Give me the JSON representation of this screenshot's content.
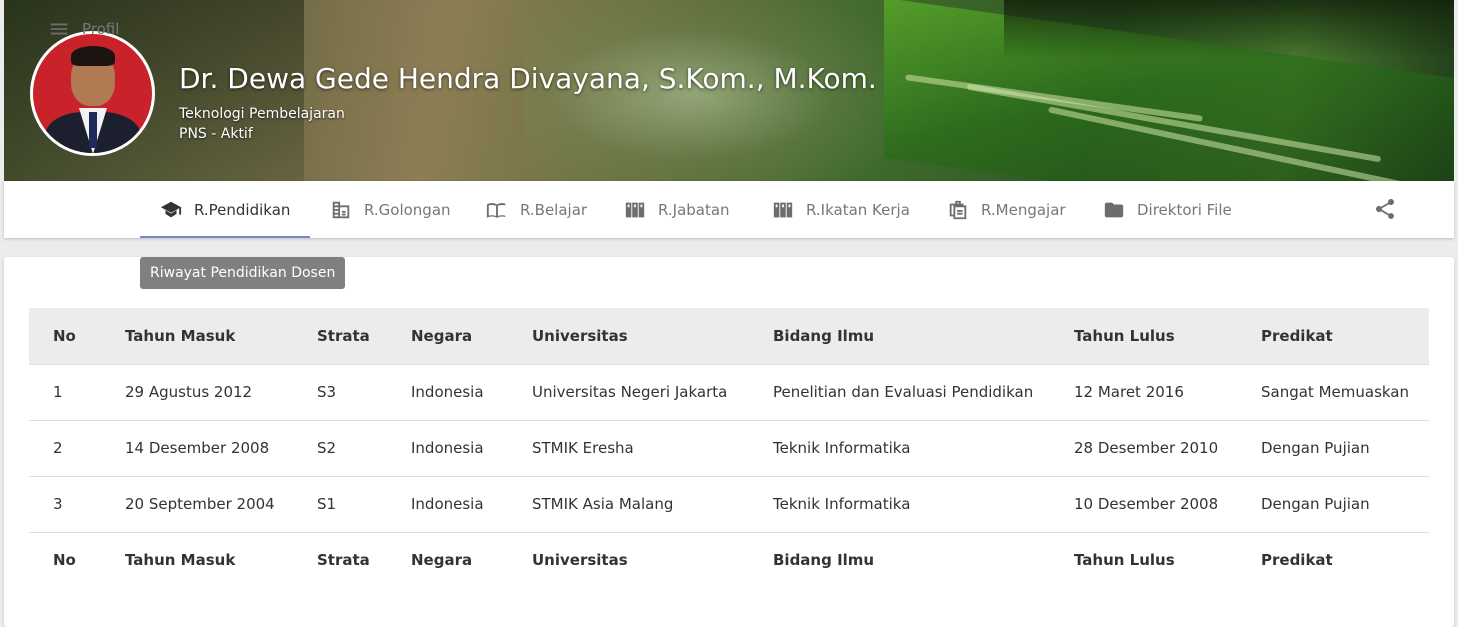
{
  "profile": {
    "name": "Dr. Dewa Gede Hendra Divayana, S.Kom., M.Kom.",
    "department": "Teknologi Pembelajaran",
    "status": "PNS - Aktif"
  },
  "tabs": [
    {
      "label": "Profil",
      "icon": "menu-icon"
    },
    {
      "label": "R.Pendidikan",
      "icon": "graduation-cap-icon",
      "active": true
    },
    {
      "label": "R.Golongan",
      "icon": "building-chart-icon"
    },
    {
      "label": "R.Belajar",
      "icon": "book-open-icon"
    },
    {
      "label": "R.Jabatan",
      "icon": "binders-icon"
    },
    {
      "label": "R.Ikatan Kerja",
      "icon": "binders-icon"
    },
    {
      "label": "R.Mengajar",
      "icon": "clipboard-icon"
    },
    {
      "label": "Direktori File",
      "icon": "folder-icon"
    }
  ],
  "share_icon": "share-icon",
  "tooltip": "Riwayat Pendidikan Dosen",
  "table": {
    "headers": [
      "No",
      "Tahun Masuk",
      "Strata",
      "Negara",
      "Universitas",
      "Bidang Ilmu",
      "Tahun Lulus",
      "Predikat"
    ],
    "rows": [
      [
        "1",
        "29 Agustus 2012",
        "S3",
        "Indonesia",
        "Universitas Negeri Jakarta",
        "Penelitian dan Evaluasi Pendidikan",
        "12 Maret 2016",
        "Sangat Memuaskan"
      ],
      [
        "2",
        "14 Desember 2008",
        "S2",
        "Indonesia",
        "STMIK Eresha",
        "Teknik Informatika",
        "28 Desember 2010",
        "Dengan Pujian"
      ],
      [
        "3",
        "20 September 2004",
        "S1",
        "Indonesia",
        "STMIK Asia Malang",
        "Teknik Informatika",
        "10 Desember 2008",
        "Dengan Pujian"
      ]
    ]
  },
  "colors": {
    "active_tab_underline": "#7b85c8",
    "tooltip_bg": "#808080",
    "header_row_bg": "#ececec"
  }
}
